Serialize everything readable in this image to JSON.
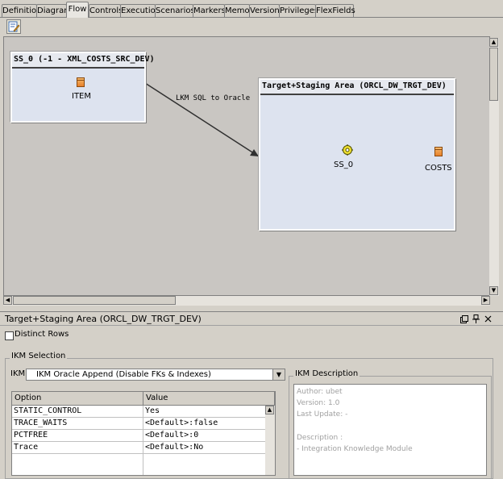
{
  "tabs": [
    {
      "label": "Definition",
      "active": false
    },
    {
      "label": "Diagram",
      "active": false
    },
    {
      "label": "Flow",
      "active": true
    },
    {
      "label": "Controls",
      "active": false
    },
    {
      "label": "Execution",
      "active": false
    },
    {
      "label": "Scenarios",
      "active": false
    },
    {
      "label": "Markers",
      "active": false
    },
    {
      "label": "Memo",
      "active": false
    },
    {
      "label": "Version",
      "active": false
    },
    {
      "label": "Privileges",
      "active": false
    },
    {
      "label": "FlexFields",
      "active": false
    }
  ],
  "toolbar": {
    "edit_icon": "edit-icon"
  },
  "diagram": {
    "source_box": {
      "title": "SS_0 (-1 - XML_COSTS_SRC_DEV)",
      "datastore": "ITEM"
    },
    "connector_label": "LKM SQL to Oracle",
    "target_box": {
      "title": "Target+Staging Area (ORCL_DW_TRGT_DEV)",
      "source_set": "SS_0",
      "datastore": "COSTS"
    }
  },
  "panel": {
    "title": "Target+Staging Area (ORCL_DW_TRGT_DEV)",
    "distinct_rows_label": "Distinct Rows",
    "distinct_rows_checked": false,
    "ikm_selection_label": "IKM Selection",
    "ikm_label": "IKM",
    "ikm_value": "IKM Oracle Append (Disable FKs & Indexes)",
    "options_table": {
      "headers": [
        "Option",
        "Value"
      ],
      "rows": [
        {
          "option": "STATIC_CONTROL",
          "value": "Yes"
        },
        {
          "option": "TRACE_WAITS",
          "value": "<Default>:false"
        },
        {
          "option": "PCTFREE",
          "value": "<Default>:0"
        },
        {
          "option": "Trace",
          "value": "<Default>:No"
        }
      ]
    },
    "ikm_description": {
      "label": "IKM Description",
      "author": "Author: ubet",
      "version": "Version: 1.0",
      "last_update": "Last Update: -",
      "description_label": "Description :",
      "description": "- Integration Knowledge Module"
    }
  }
}
